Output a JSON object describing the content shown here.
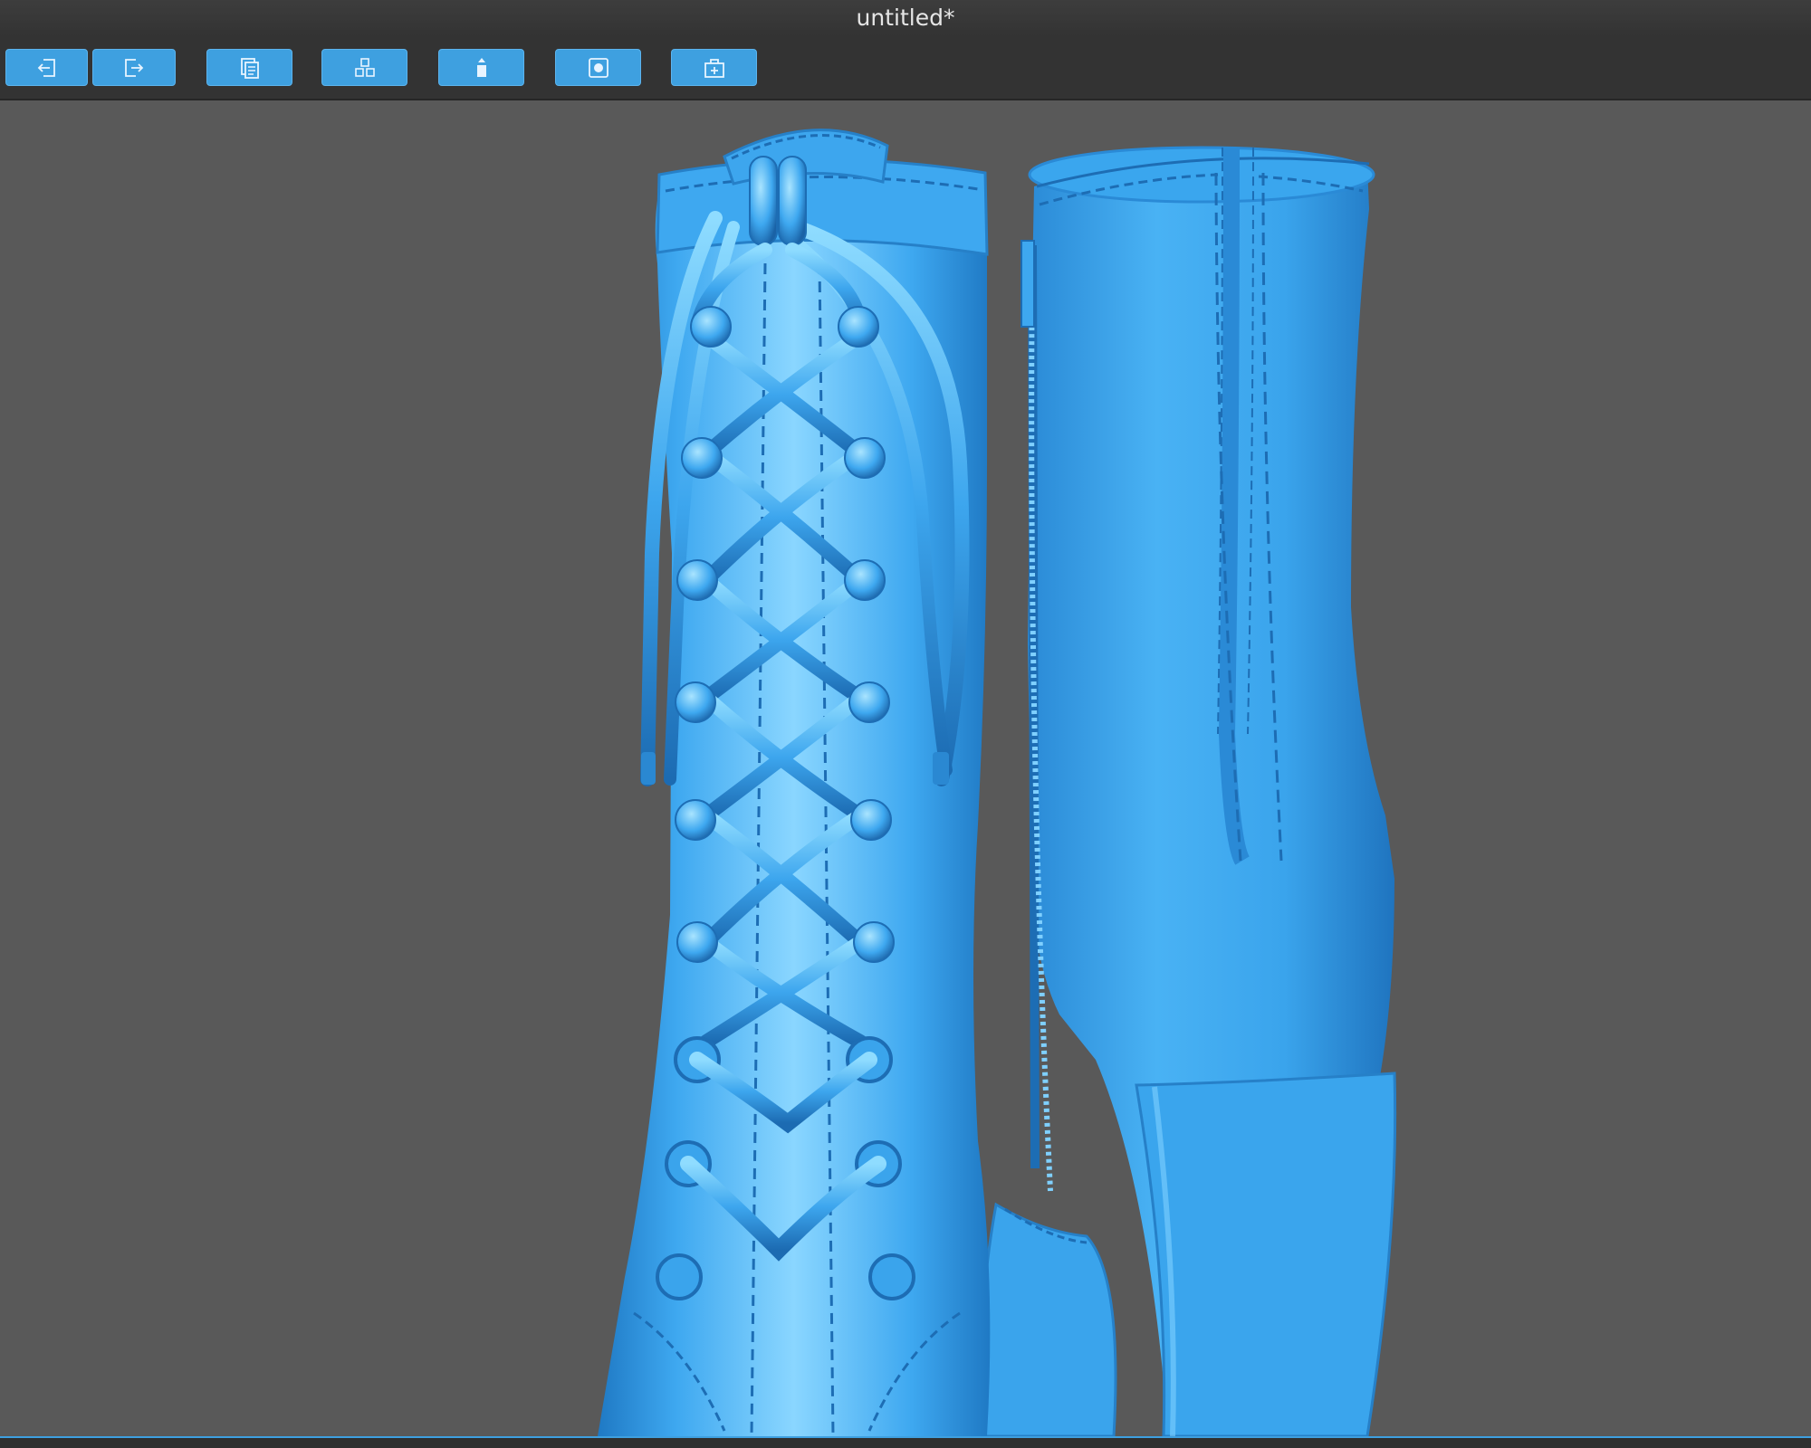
{
  "window": {
    "title": "untitled*"
  },
  "toolbar": {
    "buttons": [
      {
        "name": "import-button",
        "icon": "import-icon"
      },
      {
        "name": "export-button",
        "icon": "export-icon"
      },
      {
        "name": "copy-button",
        "icon": "copy-icon"
      },
      {
        "name": "parts-button",
        "icon": "parts-icon"
      },
      {
        "name": "upload-button",
        "icon": "upload-icon"
      },
      {
        "name": "record-button",
        "icon": "record-icon"
      },
      {
        "name": "add-box-button",
        "icon": "add-box-icon"
      }
    ]
  },
  "viewport": {
    "model": "boots-3d-model",
    "colors": {
      "background": "#595959",
      "model_base": "#3da6ee",
      "model_highlight": "#7fd0ff",
      "model_shadow": "#1f6fb3",
      "accent": "#3ea0e0"
    }
  }
}
